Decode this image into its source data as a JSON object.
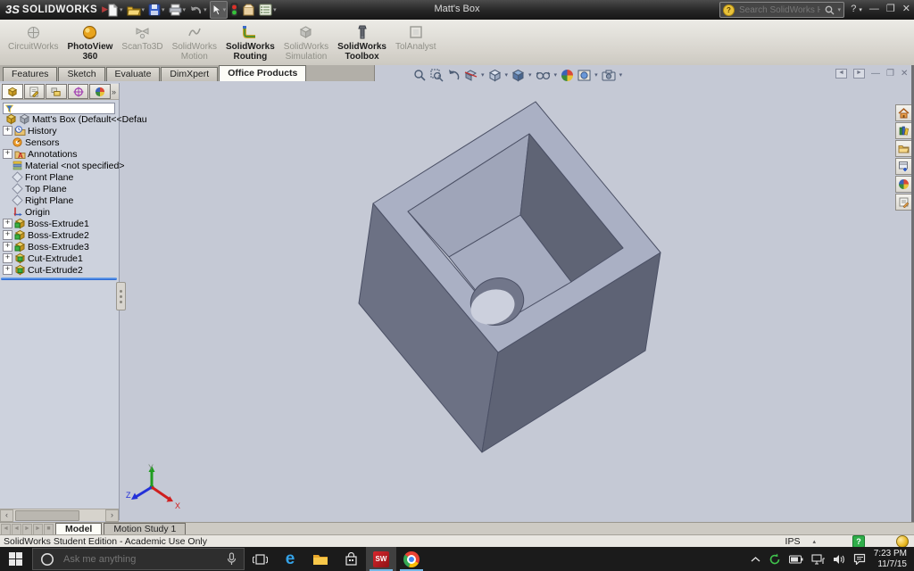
{
  "titlebar": {
    "brand_glyph": "3S",
    "brand": "SOLIDWORKS",
    "title": "Matt's Box",
    "search_placeholder": "Search SolidWorks Help"
  },
  "ribbon": {
    "items": [
      {
        "l1": "CircuitWorks",
        "l2": ""
      },
      {
        "l1": "PhotoView",
        "l2": "360"
      },
      {
        "l1": "ScanTo3D",
        "l2": ""
      },
      {
        "l1": "SolidWorks",
        "l2": "Motion"
      },
      {
        "l1": "SolidWorks",
        "l2": "Routing"
      },
      {
        "l1": "SolidWorks",
        "l2": "Simulation"
      },
      {
        "l1": "SolidWorks",
        "l2": "Toolbox"
      },
      {
        "l1": "TolAnalyst",
        "l2": ""
      }
    ]
  },
  "tabs": {
    "items": [
      "Features",
      "Sketch",
      "Evaluate",
      "DimXpert",
      "Office Products"
    ]
  },
  "tree": {
    "root_label": "Matt's Box  (Default<<Defau",
    "items": [
      "History",
      "Sensors",
      "Annotations",
      "Material <not specified>",
      "Front Plane",
      "Top Plane",
      "Right Plane",
      "Origin",
      "Boss-Extrude1",
      "Boss-Extrude2",
      "Boss-Extrude3",
      "Cut-Extrude1",
      "Cut-Extrude2"
    ]
  },
  "viewport": {
    "axis_x": "X",
    "axis_y": "Y",
    "axis_z": "Z"
  },
  "bottom_tabs": {
    "model": "Model",
    "motion_study": "Motion Study 1"
  },
  "statusbar": {
    "edition": "SolidWorks Student Edition - Academic Use Only",
    "units": "IPS"
  },
  "taskbar": {
    "search_placeholder": "Ask me anything",
    "time": "7:23 PM",
    "date": "11/7/15"
  },
  "colors": {
    "viewport_bg": "#c5c9d5",
    "model_top": "#aab0c4",
    "model_left": "#6c7184",
    "model_right": "#5e6375",
    "accent_blue": "#76b9e8",
    "rollback_blue": "#1f5fd0"
  }
}
